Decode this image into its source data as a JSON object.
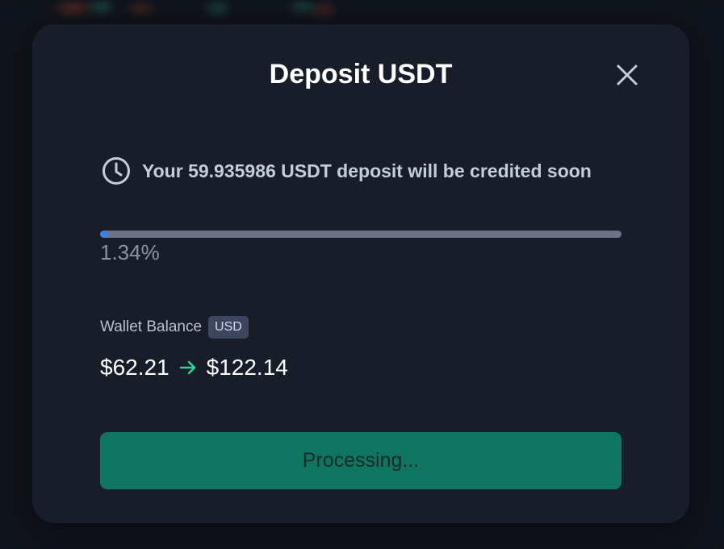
{
  "modal": {
    "title": "Deposit USDT",
    "close_icon": "close-icon",
    "status": {
      "icon": "clock-icon",
      "message": "Your 59.935986 USDT deposit will be credited soon"
    },
    "progress": {
      "value_percent": 1.34,
      "label": "1.34%"
    },
    "wallet": {
      "label": "Wallet Balance",
      "currency_badge": "USD",
      "balance_before": "$62.21",
      "balance_after": "$122.14",
      "arrow_icon": "arrow-right-icon"
    },
    "action_button": {
      "label": "Processing..."
    }
  },
  "colors": {
    "modal_bg": "#171e2a",
    "progress_fill": "#3b82e6",
    "progress_track": "#6b7385",
    "arrow": "#2fd19a",
    "button_bg": "#107560"
  }
}
